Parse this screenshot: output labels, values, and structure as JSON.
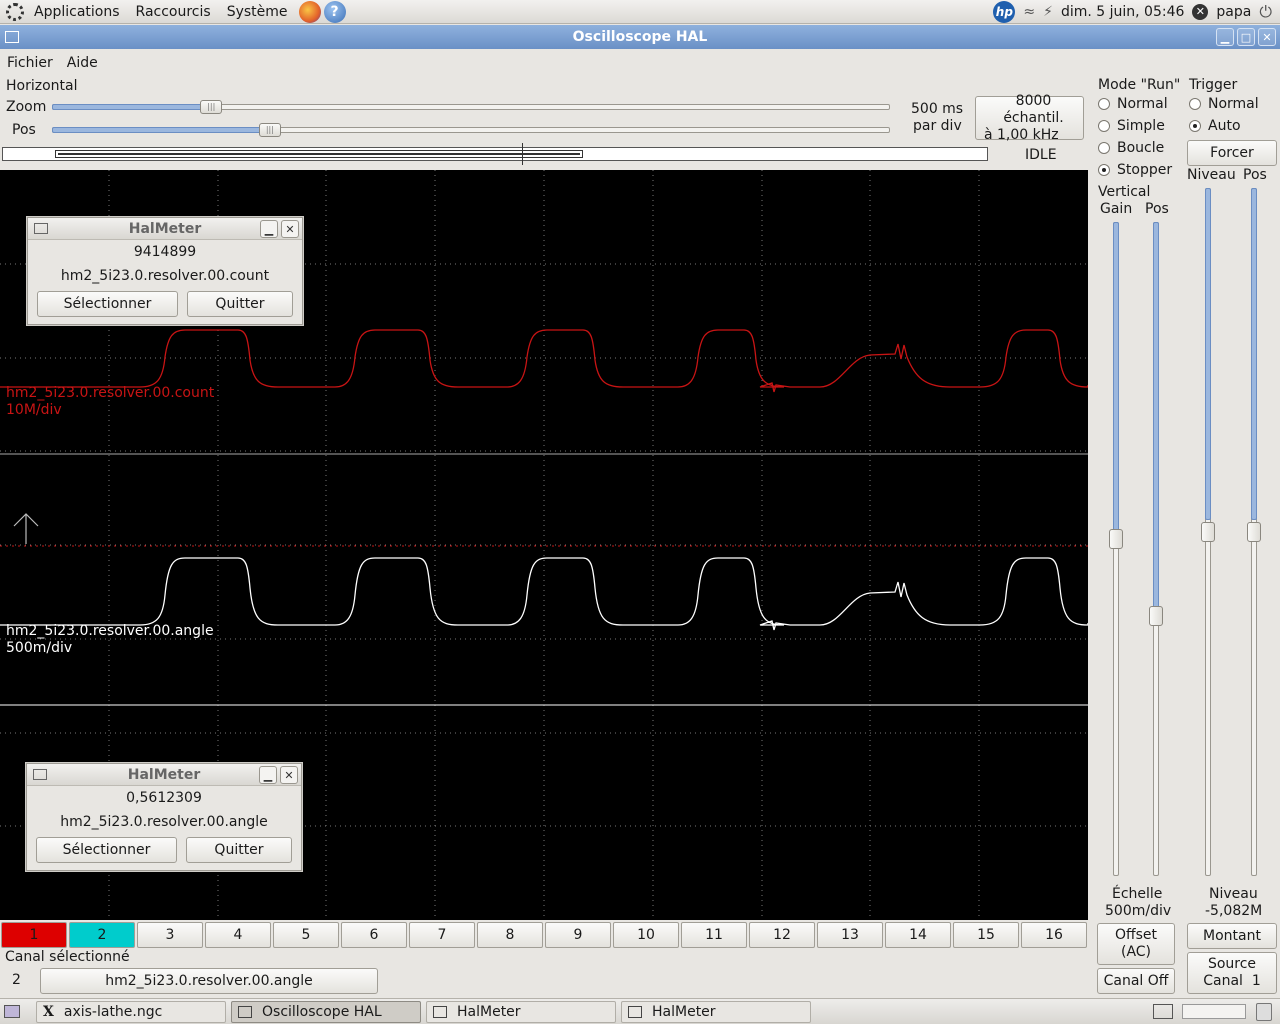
{
  "top_panel": {
    "menus": [
      "Applications",
      "Raccourcis",
      "Système"
    ],
    "clock": "dim.  5 juin, 05:46",
    "user": "papa"
  },
  "window": {
    "title": "Oscilloscope HAL",
    "menubar": [
      "Fichier",
      "Aide"
    ]
  },
  "horizontal": {
    "title": "Horizontal",
    "zoom_label": "Zoom",
    "pos_label": "Pos",
    "zoom_level": 0.19,
    "pos_level": 0.26,
    "time_div": "500 ms",
    "time_div_unit": "par div",
    "samples_line1": "8000 échantil.",
    "samples_line2": "à 1,00 kHz",
    "status": "IDLE"
  },
  "run_mode": {
    "title": "Mode \"Run\"",
    "options": [
      "Normal",
      "Simple",
      "Boucle",
      "Stopper"
    ],
    "selected": "Stopper"
  },
  "trigger": {
    "title": "Trigger",
    "options": [
      "Normal",
      "Auto"
    ],
    "selected": "Auto",
    "force_button": "Forcer",
    "level_label": "Niveau",
    "pos_label": "Pos",
    "level_caption": "Niveau",
    "level_value": "-5,082M",
    "edge_button": "Montant",
    "source_line1": "Source",
    "source_line2": "Canal  1"
  },
  "vertical": {
    "title": "Vertical",
    "gain_label": "Gain",
    "pos_label": "Pos",
    "scale_caption": "Échelle",
    "scale_value": "500m/div",
    "offset_line1": "Offset",
    "offset_line2": "(AC)",
    "channel_off": "Canal Off"
  },
  "traces": [
    {
      "name": "hm2_5i23.0.resolver.00.count",
      "scale": "10M/div",
      "color": "#c81414"
    },
    {
      "name": "hm2_5i23.0.resolver.00.angle",
      "scale": "500m/div",
      "color": "#ffffff"
    }
  ],
  "halmeters": [
    {
      "title": "HalMeter",
      "value": "9414899",
      "pin": "hm2_5i23.0.resolver.00.count",
      "select": "Sélectionner",
      "quit": "Quitter"
    },
    {
      "title": "HalMeter",
      "value": "0,5612309",
      "pin": "hm2_5i23.0.resolver.00.angle",
      "select": "Sélectionner",
      "quit": "Quitter"
    }
  ],
  "channels": [
    "1",
    "2",
    "3",
    "4",
    "5",
    "6",
    "7",
    "8",
    "9",
    "10",
    "11",
    "12",
    "13",
    "14",
    "15",
    "16"
  ],
  "channel_colors": {
    "1": "#dd0000",
    "2": "#00cccc"
  },
  "selected_channel": {
    "title": "Canal sélectionné",
    "number": "2",
    "pin": "hm2_5i23.0.resolver.00.angle"
  },
  "taskbar": [
    "axis-lathe.ngc",
    "Oscilloscope HAL",
    "HalMeter",
    "HalMeter"
  ]
}
